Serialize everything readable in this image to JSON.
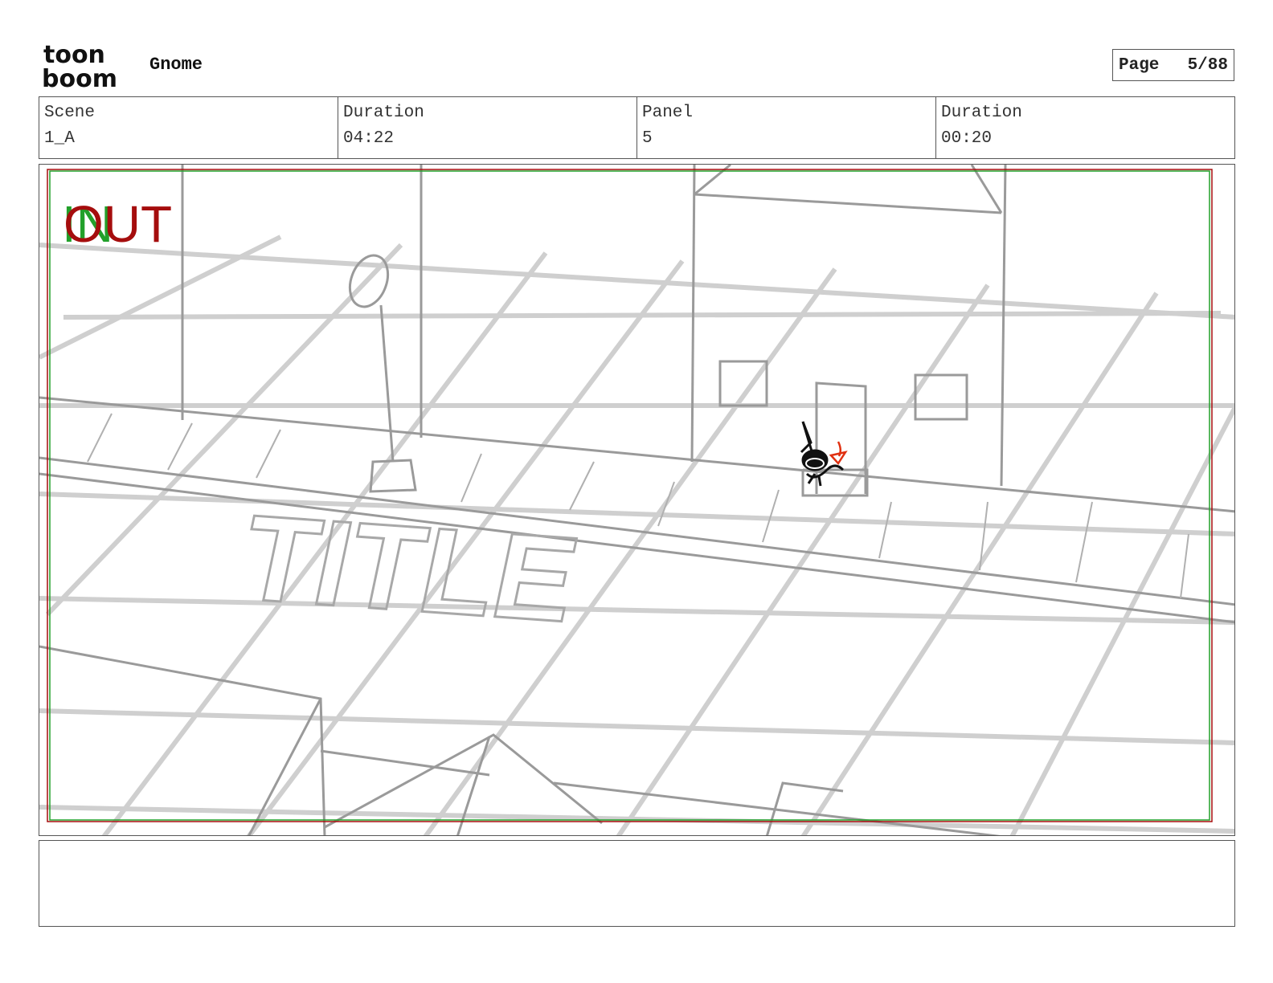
{
  "header": {
    "logo": {
      "line1": "toon",
      "line2": "boom"
    },
    "project_title": "Gnome",
    "page": {
      "label": "Page",
      "value": "5/88"
    }
  },
  "info": {
    "scene": {
      "label": "Scene",
      "value": "1_A"
    },
    "scene_duration": {
      "label": "Duration",
      "value": "04:22"
    },
    "panel": {
      "label": "Panel",
      "value": "5"
    },
    "panel_duration": {
      "label": "Duration",
      "value": "00:20"
    }
  },
  "panel_image": {
    "in_label": "IN",
    "out_label": "OUT",
    "ground_text": "TITLE",
    "colors": {
      "in": "#22a02a",
      "out": "#a50d0d",
      "sketch": "#9a9a9a",
      "grid": "#c8c8c8",
      "gnome": "#111111",
      "accent": "#e03010"
    }
  },
  "notes": {
    "text": ""
  }
}
